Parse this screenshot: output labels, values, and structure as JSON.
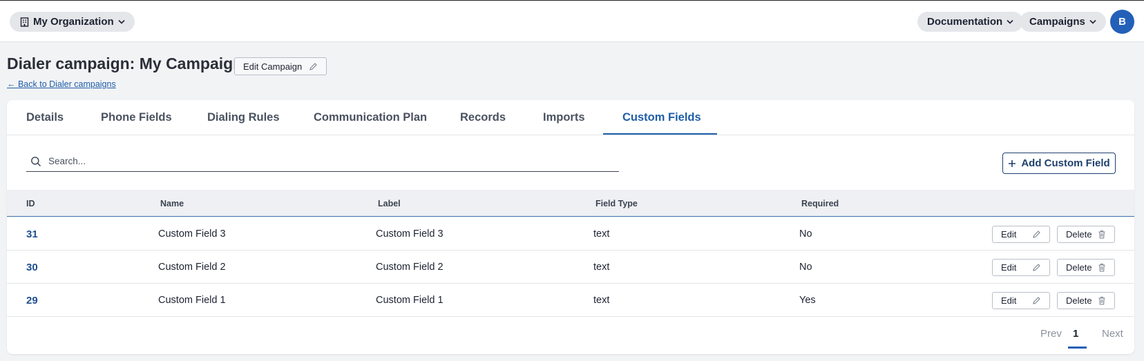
{
  "topbar": {
    "org_label": "My Organization",
    "documentation_label": "Documentation",
    "campaigns_label": "Campaigns",
    "avatar_initial": "B"
  },
  "header": {
    "title": "Dialer campaign: My Campaign",
    "edit_campaign_label": "Edit Campaign",
    "back_link": "← Back to Dialer campaigns"
  },
  "tabs": [
    {
      "label": "Details",
      "active": false
    },
    {
      "label": "Phone Fields",
      "active": false
    },
    {
      "label": "Dialing Rules",
      "active": false
    },
    {
      "label": "Communication Plan",
      "active": false
    },
    {
      "label": "Records",
      "active": false
    },
    {
      "label": "Imports",
      "active": false
    },
    {
      "label": "Custom Fields",
      "active": true
    }
  ],
  "search": {
    "placeholder": "Search...",
    "value": ""
  },
  "add_button_label": "Add Custom Field",
  "table": {
    "columns": [
      "ID",
      "Name",
      "Label",
      "Field Type",
      "Required"
    ],
    "rows": [
      {
        "id": "31",
        "name": "Custom Field 3",
        "label": "Custom Field 3",
        "field_type": "text",
        "required": "No"
      },
      {
        "id": "30",
        "name": "Custom Field 2",
        "label": "Custom Field 2",
        "field_type": "text",
        "required": "No"
      },
      {
        "id": "29",
        "name": "Custom Field 1",
        "label": "Custom Field 1",
        "field_type": "text",
        "required": "Yes"
      }
    ],
    "edit_label": "Edit",
    "delete_label": "Delete"
  },
  "pagination": {
    "prev": "Prev",
    "current": "1",
    "next": "Next"
  },
  "colors": {
    "accent": "#1f5ea8",
    "avatar": "#2360b8",
    "background": "#f2f3f5"
  }
}
